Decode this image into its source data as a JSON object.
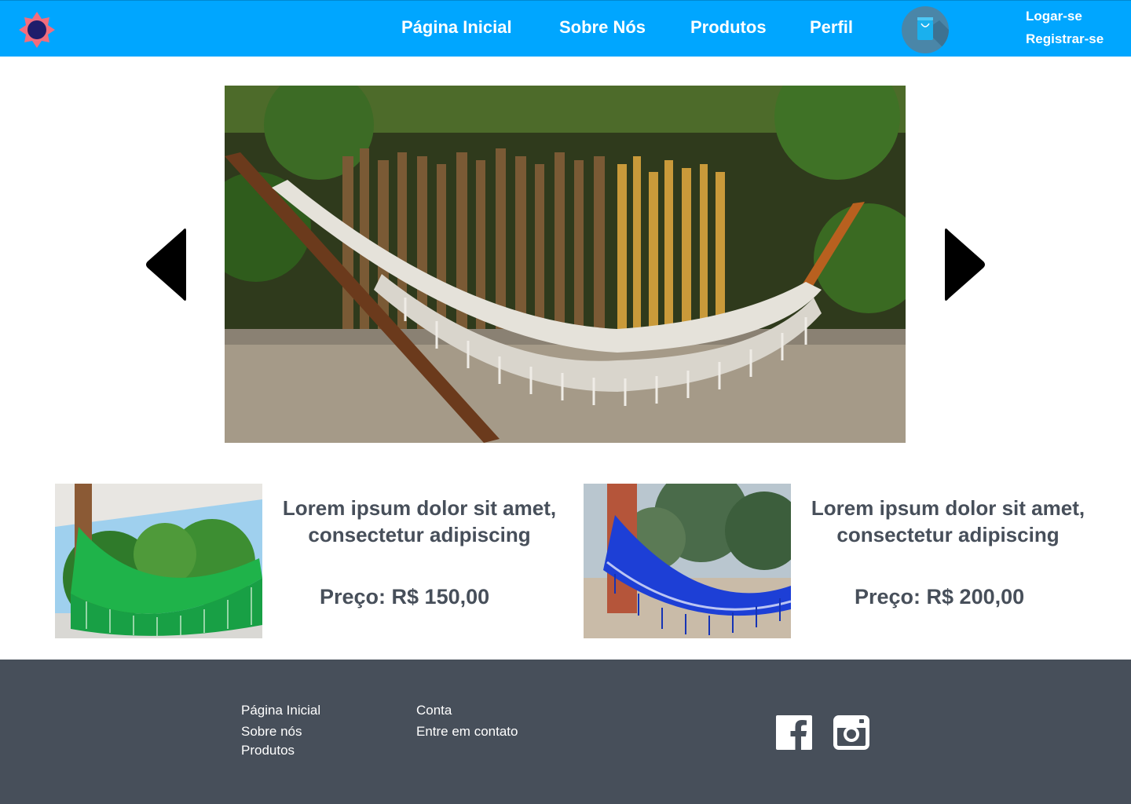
{
  "header": {
    "logo_icon": "sun-badge-logo",
    "nav": [
      {
        "label": "Página Inicial"
      },
      {
        "label": "Sobre Nós"
      },
      {
        "label": "Produtos"
      },
      {
        "label": "Perfil"
      }
    ],
    "cart_icon": "shopping-bag-icon",
    "login_label": "Logar-se",
    "register_label": "Registrar-se"
  },
  "carousel": {
    "prev_icon": "chevron-left-icon",
    "next_icon": "chevron-right-icon"
  },
  "products": [
    {
      "title": "Lorem ipsum dolor sit amet, consectetur adipiscing",
      "price": "Preço: R$ 150,00",
      "color": "#1fb34a"
    },
    {
      "title": "Lorem ipsum dolor sit amet, consectetur adipiscing",
      "price": "Preço: R$ 200,00",
      "color": "#1d3fd6"
    }
  ],
  "footer": {
    "links_col1": [
      "Página Inicial",
      "Sobre nós",
      "Produtos"
    ],
    "links_col2": [
      "Conta",
      "Entre em contato"
    ],
    "social_icons": [
      "facebook-icon",
      "instagram-icon"
    ]
  },
  "colors": {
    "header_bg": "#00a6ff",
    "footer_bg": "#474f5a",
    "text_dark": "#474f5a"
  }
}
